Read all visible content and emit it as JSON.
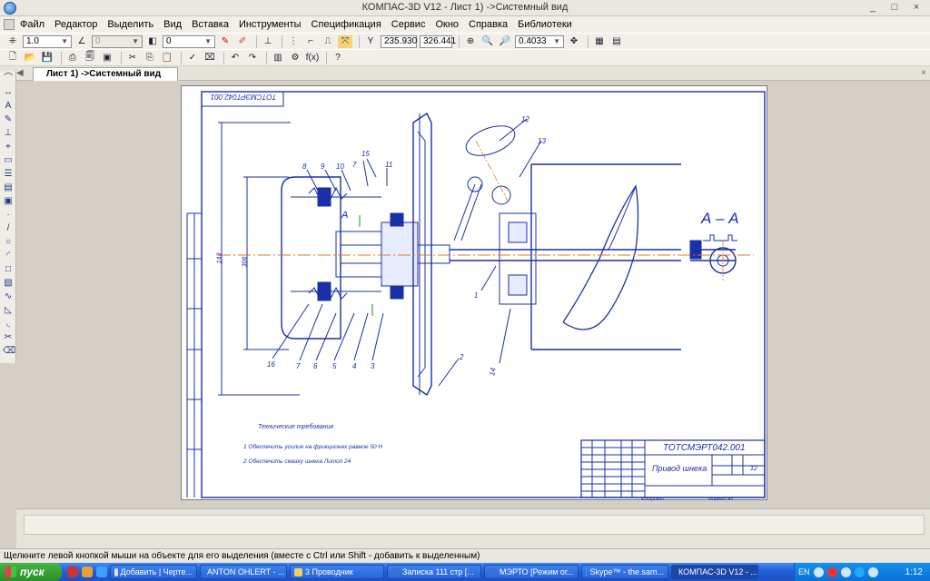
{
  "window": {
    "title": "КОМПАС-3D V12 - Лист 1) ->Системный вид",
    "controls": [
      "_",
      "□",
      "×"
    ]
  },
  "menu": [
    "Файл",
    "Редактор",
    "Выделить",
    "Вид",
    "Вставка",
    "Инструменты",
    "Спецификация",
    "Сервис",
    "Окно",
    "Справка",
    "Библиотеки"
  ],
  "toolbar1": {
    "step_value": "1.0",
    "layer_value": "0",
    "style_value": "0",
    "coord_x": "235.930",
    "coord_y": "326.441",
    "zoom_value": "0.4033"
  },
  "tabs": {
    "active_label": "Лист 1) ->Системный вид"
  },
  "drawing": {
    "stamp_designation": "ТОТСМЭРТ042.001",
    "stamp_designation_top": "ТОТСМЭРТ042.001",
    "title": "Привод шнека",
    "section_label": "А – А",
    "tech_requirements_title": "Технические требования",
    "tech_req_1": "1 Обеспечить усилие на фрикционах равное 50 Н",
    "tech_req_2": "2 Обеспечить смазку шнека Литол 24",
    "sheet_number": "12",
    "callouts": [
      "12",
      "13",
      "15",
      "8",
      "9",
      "10",
      "7",
      "11",
      "16",
      "7",
      "6",
      "5",
      "4",
      "3",
      "2",
      "1",
      "14"
    ],
    "section_mark": "А",
    "format_label": "Формат",
    "format_value": "А2",
    "copied_label": "Копировал",
    "dim_left": "143",
    "dim_inner": "308"
  },
  "status": {
    "hint": "Щелкните левой кнопкой мыши на объекте для его выделения (вместе с Ctrl или Shift - добавить к выделенным)"
  },
  "taskbar": {
    "start_label": "пуск",
    "tasks": [
      "Добавить | Черте...",
      "ANTON OHLERT - ...",
      "3 Проводник",
      "Записка 111 стр [...",
      "МЭРТО [Режим ог...",
      "Skype™ - the.sam...",
      "КОМПАС-3D V12 - ..."
    ],
    "lang": "EN",
    "clock": "1:12"
  }
}
